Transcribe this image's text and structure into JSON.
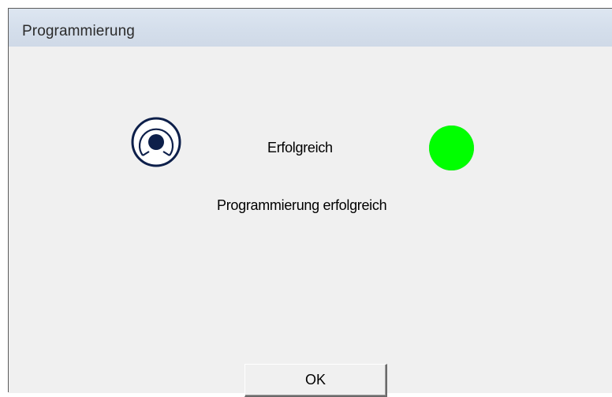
{
  "window": {
    "title": "Programmierung"
  },
  "status": {
    "label": "Erfolgreich",
    "indicator_color": "#00ff00",
    "device_icon": "transponder-icon"
  },
  "message": "Programmierung erfolgreich",
  "buttons": {
    "ok_label": "OK"
  }
}
